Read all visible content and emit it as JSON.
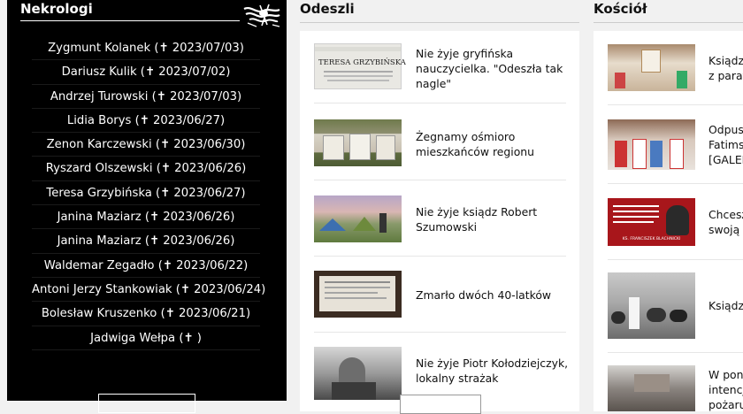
{
  "nekrologi": {
    "title": "Nekrologi",
    "items": [
      "Zygmunt Kolanek (✝ 2023/07/03)",
      "Dariusz Kulik (✝ 2023/07/02)",
      "Andrzej Turowski (✝ 2023/07/03)",
      "Lidia Borys (✝ 2023/06/27)",
      "Zenon Karczewski (✝ 2023/06/30)",
      "Ryszard Olszewski (✝ 2023/06/26)",
      "Teresa Grzybińska (✝ 2023/06/27)",
      "Janina Maziarz (✝ 2023/06/26)",
      "Janina Maziarz (✝ 2023/06/26)",
      "Waldemar Zegadło (✝ 2023/06/22)",
      "Antoni Jerzy Stankowiak (✝ 2023/06/24)",
      "Bolesław Kruszenko (✝ 2023/06/21)",
      "Jadwiga Wełpa (✝ )"
    ]
  },
  "odeszli": {
    "title": "Odeszli",
    "articles": [
      {
        "lines": [
          "Nie żyje gryfińska",
          "nauczycielka. \"Odeszła tak",
          "nagle\""
        ],
        "thumb_text": "TERESA GRZYBIŃSKA"
      },
      {
        "lines": [
          "Żegnamy ośmioro",
          "mieszkańców regionu"
        ]
      },
      {
        "lines": [
          "Nie żyje ksiądz Robert",
          "Szumowski"
        ]
      },
      {
        "lines": [
          "Zmarło dwóch 40-latków"
        ]
      },
      {
        "lines": [
          "Nie żyje Piotr Kołodziejczyk,",
          "lokalny strażak"
        ]
      }
    ]
  },
  "kosciol": {
    "title": "Kościół",
    "articles": [
      {
        "lines": [
          "Ksiądz",
          "z paraf"
        ]
      },
      {
        "lines": [
          "Odpust",
          "Fatimsk",
          "[GALER"
        ]
      },
      {
        "lines": [
          "Chcesz",
          "swoją w"
        ],
        "thumb_text": "KS. FRANCISZEK BLACHNICKI"
      },
      {
        "lines": [
          "Ksiądz"
        ]
      },
      {
        "lines": [
          "W ponie",
          "intencji",
          "pożaru"
        ]
      }
    ]
  },
  "colors": {
    "sidebar_bg": "#000000",
    "page_bg": "#f1f1f1",
    "card_bg": "#ffffff"
  }
}
